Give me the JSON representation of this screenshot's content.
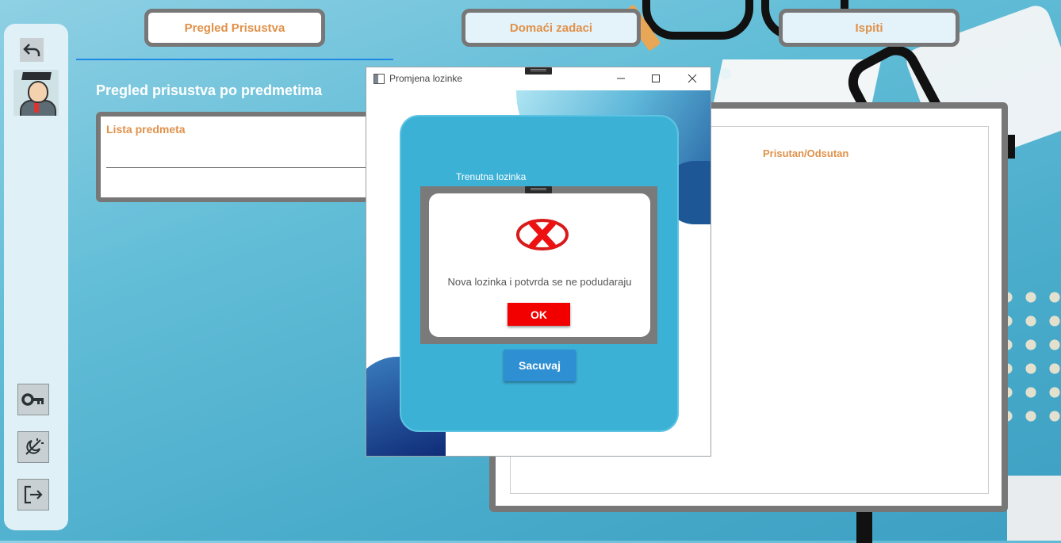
{
  "tabs": [
    {
      "label": "Pregled Prisustva",
      "active": true
    },
    {
      "label": "Domaći zadaci",
      "active": false
    },
    {
      "label": "Ispiti",
      "active": false
    }
  ],
  "page": {
    "title": "Pregled prisustva po predmetima"
  },
  "subject_list": {
    "header": "Lista predmeta"
  },
  "attendance": {
    "column_header": "Prisutan/Odsutan"
  },
  "sidebar": {
    "back_icon": "undo-arrow-icon",
    "avatar": "graduate-avatar",
    "buttons": [
      {
        "name": "change-password-button",
        "icon": "key-icon"
      },
      {
        "name": "theme-toggle-button",
        "icon": "moon-sun-icon"
      },
      {
        "name": "logout-button",
        "icon": "logout-icon"
      }
    ]
  },
  "password_window": {
    "title": "Promjena lozinke",
    "current_password_label": "Trenutna lozinka",
    "save_label": "Sacuvaj"
  },
  "message_dialog": {
    "message": "Nova lozinka i potvrda se ne podudaraju",
    "ok_label": "OK",
    "icon": "error-x-icon"
  },
  "colors": {
    "accent_orange": "#e0914a",
    "card_blue": "#3cb1d6",
    "save_blue": "#2e8fd3",
    "error_red": "#f20000"
  }
}
